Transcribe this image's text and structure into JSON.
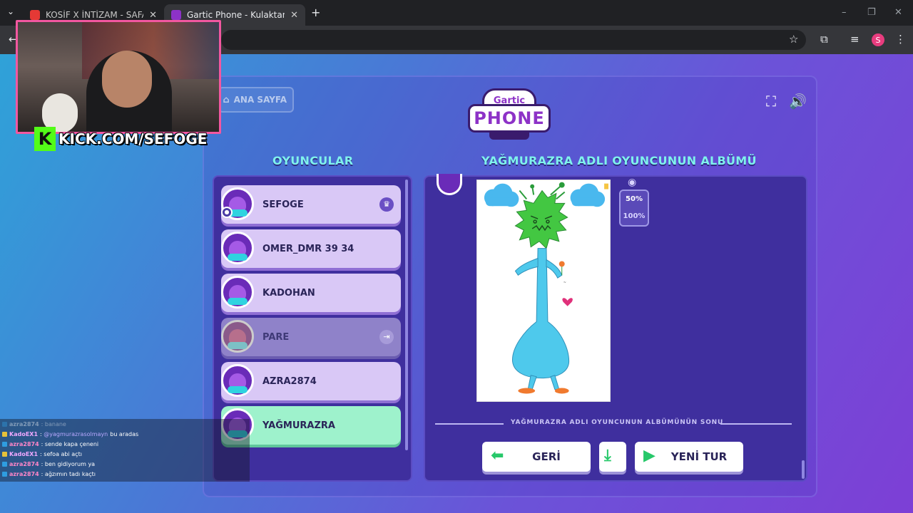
{
  "browser": {
    "tabs": [
      {
        "title": "KOSİF X İNTİZAM - SAFARİ ( OF",
        "active": false
      },
      {
        "title": "Gartic Phone - Kulaktan Kulağa",
        "active": true
      }
    ],
    "new_tab": "+"
  },
  "game": {
    "home_button": "ANA SAYFA",
    "logo_top": "Gartic",
    "logo_bottom": "PHONE",
    "players_heading": "OYUNCULAR",
    "album_heading": "YAĞMURAZRA ADLI OYUNCUNUN ALBÜMÜ",
    "players": [
      {
        "name": "SEFOGE",
        "state": "normal",
        "badge": "crown"
      },
      {
        "name": "OMER_DMR 39 34",
        "state": "normal"
      },
      {
        "name": "KADOHAN",
        "state": "normal"
      },
      {
        "name": "PARE",
        "state": "dimmed",
        "badge": "exit"
      },
      {
        "name": "AZRA2874",
        "state": "normal"
      },
      {
        "name": "YAĞMURAZRA",
        "state": "highlighted"
      }
    ],
    "zoom_options": [
      "50%",
      "100%"
    ],
    "album_end_text": "YAĞMURAZRA ADLI OYUNCUNUN ALBÜMÜNÜN SONU",
    "back_button": "GERİ",
    "new_round_button": "YENİ TUR"
  },
  "stream": {
    "kick_letter": "K",
    "kick_url": "KICK.COM/SEFOGE"
  },
  "chat": [
    {
      "user": "azra2874",
      "text": ": banane",
      "faded": true,
      "badge_color": "#2f9de0"
    },
    {
      "user": "KadoEX1",
      "mention": "@yagmurazrasolmayn",
      "text": "bu aradas",
      "badge_color": "#e6c23a",
      "user_color": "#f0a8ff"
    },
    {
      "user": "azra2874",
      "text": ": sende kapa çeneni",
      "badge_color": "#2f9de0",
      "user_color": "#ff86c8"
    },
    {
      "user": "KadoEX1",
      "text": ": sefoa abi açtı",
      "badge_color": "#e6c23a",
      "user_color": "#f0a8ff"
    },
    {
      "user": "azra2874",
      "text": ": ben gidiyorum ya",
      "badge_color": "#2f9de0",
      "user_color": "#ff86c8"
    },
    {
      "user": "azra2874",
      "text": ": ağzımın tadı kaçtı",
      "badge_color": "#2f9de0",
      "user_color": "#ff86c8"
    }
  ],
  "colors": {
    "heading": "#7ff2ec",
    "panel": "#3f2f9e",
    "highlight_row": "#9ef2cc",
    "kick_green": "#53fc18",
    "cam_border": "#f257a0"
  }
}
